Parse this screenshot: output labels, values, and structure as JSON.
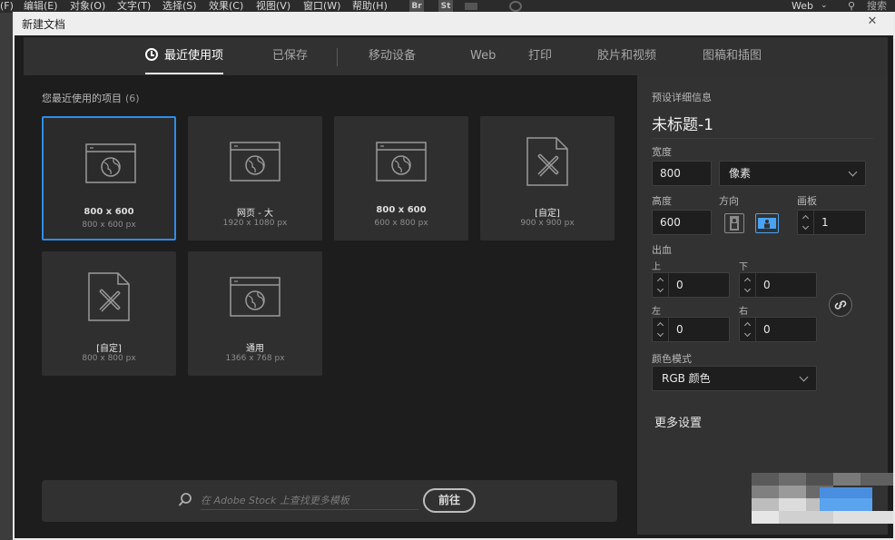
{
  "menubar": {
    "items": [
      "(F)",
      "编辑(E)",
      "对象(O)",
      "文字(T)",
      "选择(S)",
      "效果(C)",
      "视图(V)",
      "窗口(W)",
      "帮助(H)"
    ],
    "br_chip": "Br",
    "st_chip": "St",
    "workspace": "Web",
    "search_label": "搜索"
  },
  "dialog": {
    "title": "新建文档",
    "tabs": [
      "最近使用项",
      "已保存",
      "移动设备",
      "Web",
      "打印",
      "胶片和视频",
      "图稿和插图"
    ],
    "active_tab": 0
  },
  "recent": {
    "heading": "您最近使用的项目",
    "count": "(6)",
    "items": [
      {
        "name": "800 x 600",
        "size": "800 x 600 px",
        "icon": "web-document-icon"
      },
      {
        "name": "网页 - 大",
        "size": "1920 x 1080 px",
        "icon": "web-document-icon"
      },
      {
        "name": "800 x 600",
        "size": "600 x 800 px",
        "icon": "web-document-icon"
      },
      {
        "name": "[自定]",
        "size": "900 x 900 px",
        "icon": "custom-document-icon"
      },
      {
        "name": "[自定]",
        "size": "800 x 800 px",
        "icon": "custom-document-icon"
      },
      {
        "name": "通用",
        "size": "1366 x 768 px",
        "icon": "web-document-icon"
      }
    ]
  },
  "stock": {
    "placeholder": "在 Adobe Stock 上查找更多模板",
    "go_label": "前往"
  },
  "preset": {
    "heading": "预设详细信息",
    "name": "未标题-1",
    "width_label": "宽度",
    "width": "800",
    "unit": "像素",
    "height_label": "高度",
    "height": "600",
    "orientation_label": "方向",
    "orientation": "landscape",
    "artboards_label": "画板",
    "artboards": "1",
    "bleed_label": "出血",
    "bleed_top_label": "上",
    "bleed_top": "0",
    "bleed_bottom_label": "下",
    "bleed_bottom": "0",
    "bleed_left_label": "左",
    "bleed_left": "0",
    "bleed_right_label": "右",
    "bleed_right": "0",
    "color_mode_label": "颜色模式",
    "color_mode": "RGB 颜色",
    "more_settings": "更多设置"
  },
  "colors": {
    "accent": "#2d8ceb",
    "dialog_bg": "#1d1d1d",
    "panel_bg": "#323232"
  }
}
